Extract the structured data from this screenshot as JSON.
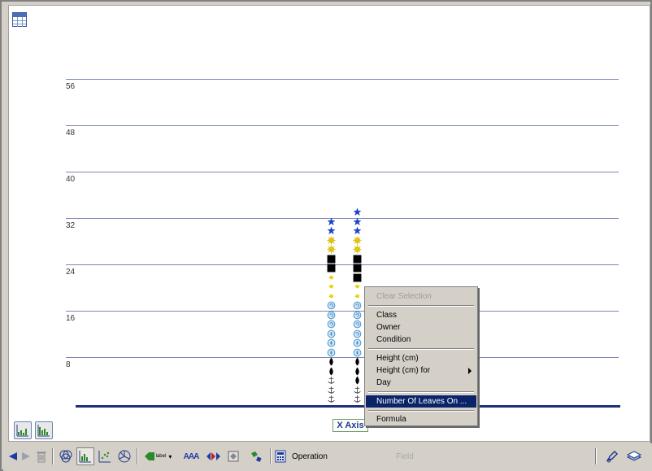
{
  "chart": {
    "y_ticks": [
      "56",
      "48",
      "40",
      "32",
      "24",
      "16",
      "8"
    ],
    "x_axis_label": "X Axis",
    "columns": [
      [
        "anchor",
        "anchor",
        "anchor",
        "drop",
        "drop",
        "waterdrop",
        "waterdrop",
        "waterdrop",
        "swirl",
        "swirl",
        "swirl",
        "spark",
        "spark",
        "spark",
        "square",
        "square",
        "sun",
        "sun",
        "star",
        "star"
      ],
      [
        "anchor",
        "anchor",
        "drop",
        "drop",
        "drop",
        "waterdrop",
        "waterdrop",
        "swirl",
        "swirl",
        "swirl",
        "swirl",
        "spark",
        "spark",
        "square",
        "square",
        "square",
        "sun",
        "sun",
        "star",
        "star",
        "star"
      ]
    ]
  },
  "context_menu": {
    "items": [
      {
        "label": "Clear Selection",
        "state": "disabled"
      },
      {
        "label": "Class",
        "state": "normal"
      },
      {
        "label": "Owner",
        "state": "normal"
      },
      {
        "label": "Condition",
        "state": "normal"
      },
      {
        "label": "Height (cm)",
        "state": "normal"
      },
      {
        "label": "Height (cm) for",
        "state": "normal",
        "submenu": true
      },
      {
        "label": "Day",
        "state": "normal"
      },
      {
        "label": "Number Of Leaves On ...",
        "state": "selected"
      },
      {
        "label": "Formula",
        "state": "normal"
      }
    ]
  },
  "toolbar": {
    "label_button": "label",
    "aaa_button": "AAA",
    "operation_label": "Operation",
    "field_label": "Field"
  },
  "icons": {
    "table": "table-icon",
    "back": "arrow-left-icon",
    "forward": "arrow-right-icon",
    "trash": "trash-icon",
    "venn": "venn-icon",
    "bar_graph": "bar-graph-icon",
    "scatter": "scatter-plot-icon",
    "pie": "pie-chart-icon",
    "label": "label-icon",
    "text": "text-size-icon",
    "color": "color-icon",
    "shape": "shape-icon",
    "paint": "paint-icon",
    "calculator": "calculator-icon",
    "edit": "edit-icon",
    "layers": "layers-icon"
  }
}
